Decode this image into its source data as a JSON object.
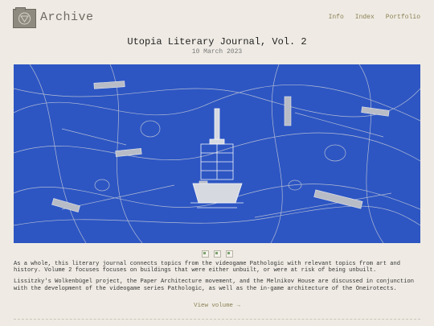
{
  "header": {
    "brand": "Archive",
    "nav": [
      "Info",
      "Index",
      "Portfolio"
    ]
  },
  "post": {
    "title": "Utopia Literary Journal, Vol. 2",
    "date": "10 March 2023",
    "paragraphs": [
      "As a whole, this literary journal connects topics from the videogame Pathologic with relevant topics from art and history. Volume 2 focuses focuses on buildings that were either unbuilt, or were at risk of being unbuilt.",
      "Lissitzky's Wolkenbügel project, the Paper Architecture movement, and the Melnikov House are discussed in conjunction with the development of the videogame series Pathologic, as well as the in-game architecture of the Oneirotects."
    ],
    "view_link": "View volume →"
  },
  "hero": {
    "background_color": "#2d56c3",
    "line_color": "#c9ccd6"
  },
  "thumbnails": {
    "count": 3
  },
  "icons": {
    "logo": "folder-seal-icon"
  }
}
